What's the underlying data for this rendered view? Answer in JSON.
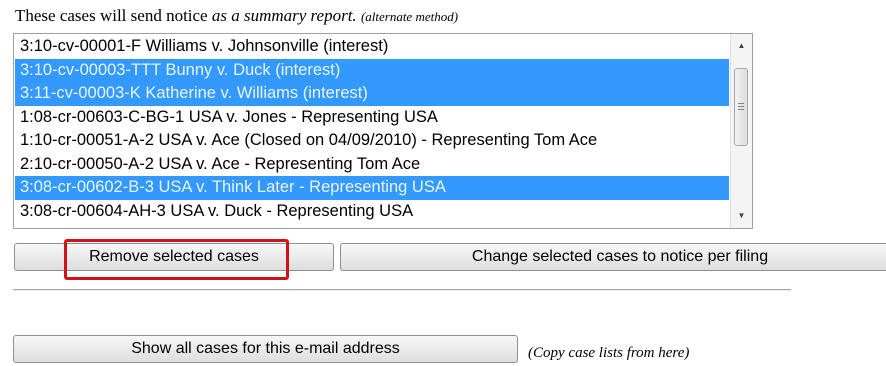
{
  "header": {
    "text_plain": "These cases will send notice ",
    "text_italic": "as a summary report.",
    "text_small_italic": "(alternate method)"
  },
  "case_list": {
    "items": [
      {
        "label": "3:10-cv-00001-F Williams v. Johnsonville (interest)",
        "selected": false
      },
      {
        "label": "3:10-cv-00003-TTT Bunny v. Duck (interest)",
        "selected": true
      },
      {
        "label": "3:11-cv-00003-K Katherine v. Williams (interest)",
        "selected": true
      },
      {
        "label": "1:08-cr-00603-C-BG-1 USA v. Jones - Representing USA",
        "selected": false
      },
      {
        "label": "1:10-cr-00051-A-2 USA v. Ace (Closed on 04/09/2010) - Representing Tom Ace",
        "selected": false
      },
      {
        "label": "2:10-cr-00050-A-2 USA v. Ace - Representing Tom Ace",
        "selected": false
      },
      {
        "label": "3:08-cr-00602-B-3 USA v. Think Later - Representing USA",
        "selected": true
      },
      {
        "label": "3:08-cr-00604-AH-3 USA v. Duck - Representing USA",
        "selected": false
      }
    ],
    "scrollbar": {
      "up_glyph": "▲",
      "down_glyph": "▼"
    }
  },
  "buttons": {
    "remove_label": "Remove selected cases",
    "change_label": "Change selected cases to notice per filing",
    "show_all_label": "Show all cases for this e-mail address"
  },
  "note": "(Copy case lists from here)",
  "colors": {
    "selection": "#3399ff",
    "highlight_box": "#d0121b"
  }
}
